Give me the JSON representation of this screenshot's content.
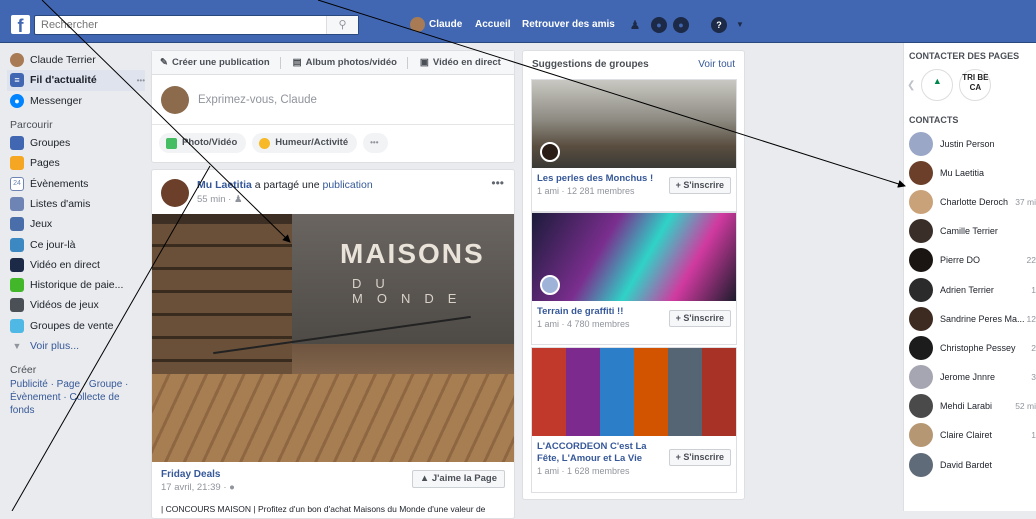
{
  "topbar": {
    "search_placeholder": "Rechercher",
    "user_name": "Claude",
    "home_label": "Accueil",
    "find_friends_label": "Retrouver des amis"
  },
  "sidebar": {
    "profile_name": "Claude Terrier",
    "items": [
      {
        "label": "Fil d'actualité",
        "more": "•••"
      },
      {
        "label": "Messenger"
      }
    ],
    "explore_title": "Parcourir",
    "explore": [
      {
        "label": "Groupes",
        "icon": "groups-icon",
        "color": "#4267b2"
      },
      {
        "label": "Pages",
        "icon": "flag-icon",
        "color": "#f5a623"
      },
      {
        "label": "Évènements",
        "icon": "calendar-icon",
        "color": "#6d84b4",
        "glyph": "24"
      },
      {
        "label": "Listes d'amis",
        "icon": "friends-list-icon",
        "color": "#6d84b4"
      },
      {
        "label": "Jeux",
        "icon": "games-icon",
        "color": "#4a6ea9"
      },
      {
        "label": "Ce jour-là",
        "icon": "clock-icon",
        "color": "#3b88c3"
      },
      {
        "label": "Vidéo en direct",
        "icon": "video-icon",
        "color": "#1d2a47"
      },
      {
        "label": "Historique de paie...",
        "icon": "payment-icon",
        "color": "#42b72a"
      },
      {
        "label": "Vidéos de jeux",
        "icon": "gamepad-icon",
        "color": "#4b4f56"
      },
      {
        "label": "Groupes de vente",
        "icon": "tag-icon",
        "color": "#4fb8e5"
      }
    ],
    "see_more": "Voir plus...",
    "create_title": "Créer",
    "create_links_1": "Publicité · Page · Groupe ·",
    "create_links_2": "Évènement · Collecte de fonds"
  },
  "composer": {
    "tab_publication": "Créer une publication",
    "tab_album": "Album photos/vidéo",
    "tab_live": "Vidéo en direct",
    "placeholder": "Exprimez-vous, Claude",
    "btn_photo": "Photo/Vidéo",
    "btn_mood": "Humeur/Activité",
    "btn_more": "•••"
  },
  "post": {
    "author": "Mu Laetitia",
    "action": " a partagé une ",
    "object": "publication",
    "time": "55 min · ",
    "more": "•••",
    "brand": "MAISONS",
    "brand_sub": "DU MONDE",
    "page_name": "Friday Deals",
    "page_date": "17 avril, 21:39 · ",
    "like_page": "J'aime la Page",
    "description": "| CONCOURS MAISON | Profitez d'un bon d'achat Maisons du Monde d'une valeur de"
  },
  "groups": {
    "title": "Suggestions de groupes",
    "see_all": "Voir tout",
    "join_label": "+ S'inscrire",
    "items": [
      {
        "name": "Les perles des Monchus !",
        "meta": "1 ami · 12 281 membres"
      },
      {
        "name": "Terrain de graffiti !!",
        "meta": "1 ami · 4 780 membres"
      },
      {
        "name": "L'ACCORDEON C'est La Fête, L'Amour et La Vie",
        "meta": "1 ami · 1 628 membres"
      }
    ]
  },
  "rightcol": {
    "pages_title": "CONTACTER DES PAGES",
    "page2_text": "TRI BE CA",
    "contacts_title": "CONTACTS",
    "contacts": [
      {
        "name": "Justin Person",
        "status": "",
        "color": "#9aa7c7"
      },
      {
        "name": "Mu Laetitia",
        "status": "",
        "color": "#6b3f2a"
      },
      {
        "name": "Charlotte Deroch",
        "status": "37 mi",
        "color": "#c9a27a"
      },
      {
        "name": "Camille Terrier",
        "status": "",
        "color": "#3a2e28"
      },
      {
        "name": "Pierre DO",
        "status": "22",
        "color": "#1a1512"
      },
      {
        "name": "Adrien Terrier",
        "status": "1",
        "color": "#2b2b2b"
      },
      {
        "name": "Sandrine Peres Ma...",
        "status": "12",
        "color": "#3d2a20"
      },
      {
        "name": "Christophe Pessey",
        "status": "2",
        "color": "#1c1c1c"
      },
      {
        "name": "Jerome Jnnre",
        "status": "3",
        "color": "#a6a6b3"
      },
      {
        "name": "Mehdi Larabi",
        "status": "52 mi",
        "color": "#4a4a4a"
      },
      {
        "name": "Claire Clairet",
        "status": "1",
        "color": "#b69773"
      },
      {
        "name": "David Bardet",
        "status": "",
        "color": "#5f6b78"
      }
    ]
  },
  "colors": {
    "brand": "#4267b2",
    "link": "#365899",
    "bg": "#e9ebee"
  }
}
